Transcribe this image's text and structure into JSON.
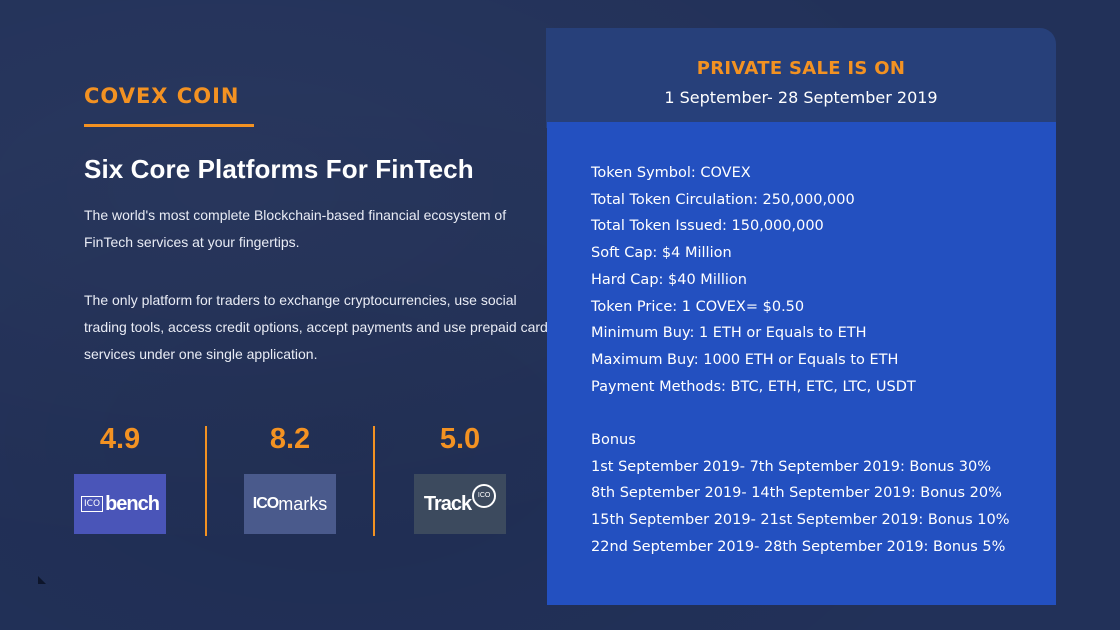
{
  "left": {
    "brand": "COVEX COIN",
    "headline": "Six Core Platforms For FinTech",
    "paragraph_1": "The world's most complete Blockchain-based financial ecosystem of FinTech services at your fingertips.",
    "paragraph_2": "The only platform for traders to exchange cryptocurrencies, use social trading tools, access credit options, accept payments and use prepaid card services under one single application.",
    "ratings": [
      {
        "score": "4.9",
        "logo_prefix": "ICO",
        "logo_text": "bench",
        "icon": "icobench-logo"
      },
      {
        "score": "8.2",
        "logo_prefix": "ICO",
        "logo_text": "marks",
        "icon": "icomarks-logo"
      },
      {
        "score": "5.0",
        "logo_prefix": "ICO",
        "logo_text": "Track",
        "icon": "trackico-logo"
      }
    ]
  },
  "sale": {
    "title": "PRIVATE SALE IS ON",
    "dates": "1 September- 28 September 2019",
    "details": [
      "Token Symbol: COVEX",
      "Total Token Circulation: 250,000,000",
      "Total Token Issued: 150,000,000",
      "Soft Cap: $4 Million",
      "Hard Cap: $40 Million",
      "Token Price: 1 COVEX= $0.50",
      "Minimum Buy: 1 ETH or Equals to ETH",
      "Maximum Buy: 1000 ETH or Equals to ETH",
      "Payment Methods: BTC, ETH, ETC, LTC, USDT"
    ],
    "bonus_heading": "Bonus",
    "bonus_items": [
      "1st September 2019- 7th September 2019:  Bonus 30%",
      "8th September 2019- 14th September 2019: Bonus 20%",
      "15th September 2019- 21st September 2019: Bonus 10%",
      "22nd September 2019- 28th September 2019: Bonus 5%"
    ]
  },
  "colors": {
    "background": "#223159",
    "accent_orange": "#f39222",
    "panel_blue": "#2350c0",
    "panel_header": "#27407a"
  }
}
